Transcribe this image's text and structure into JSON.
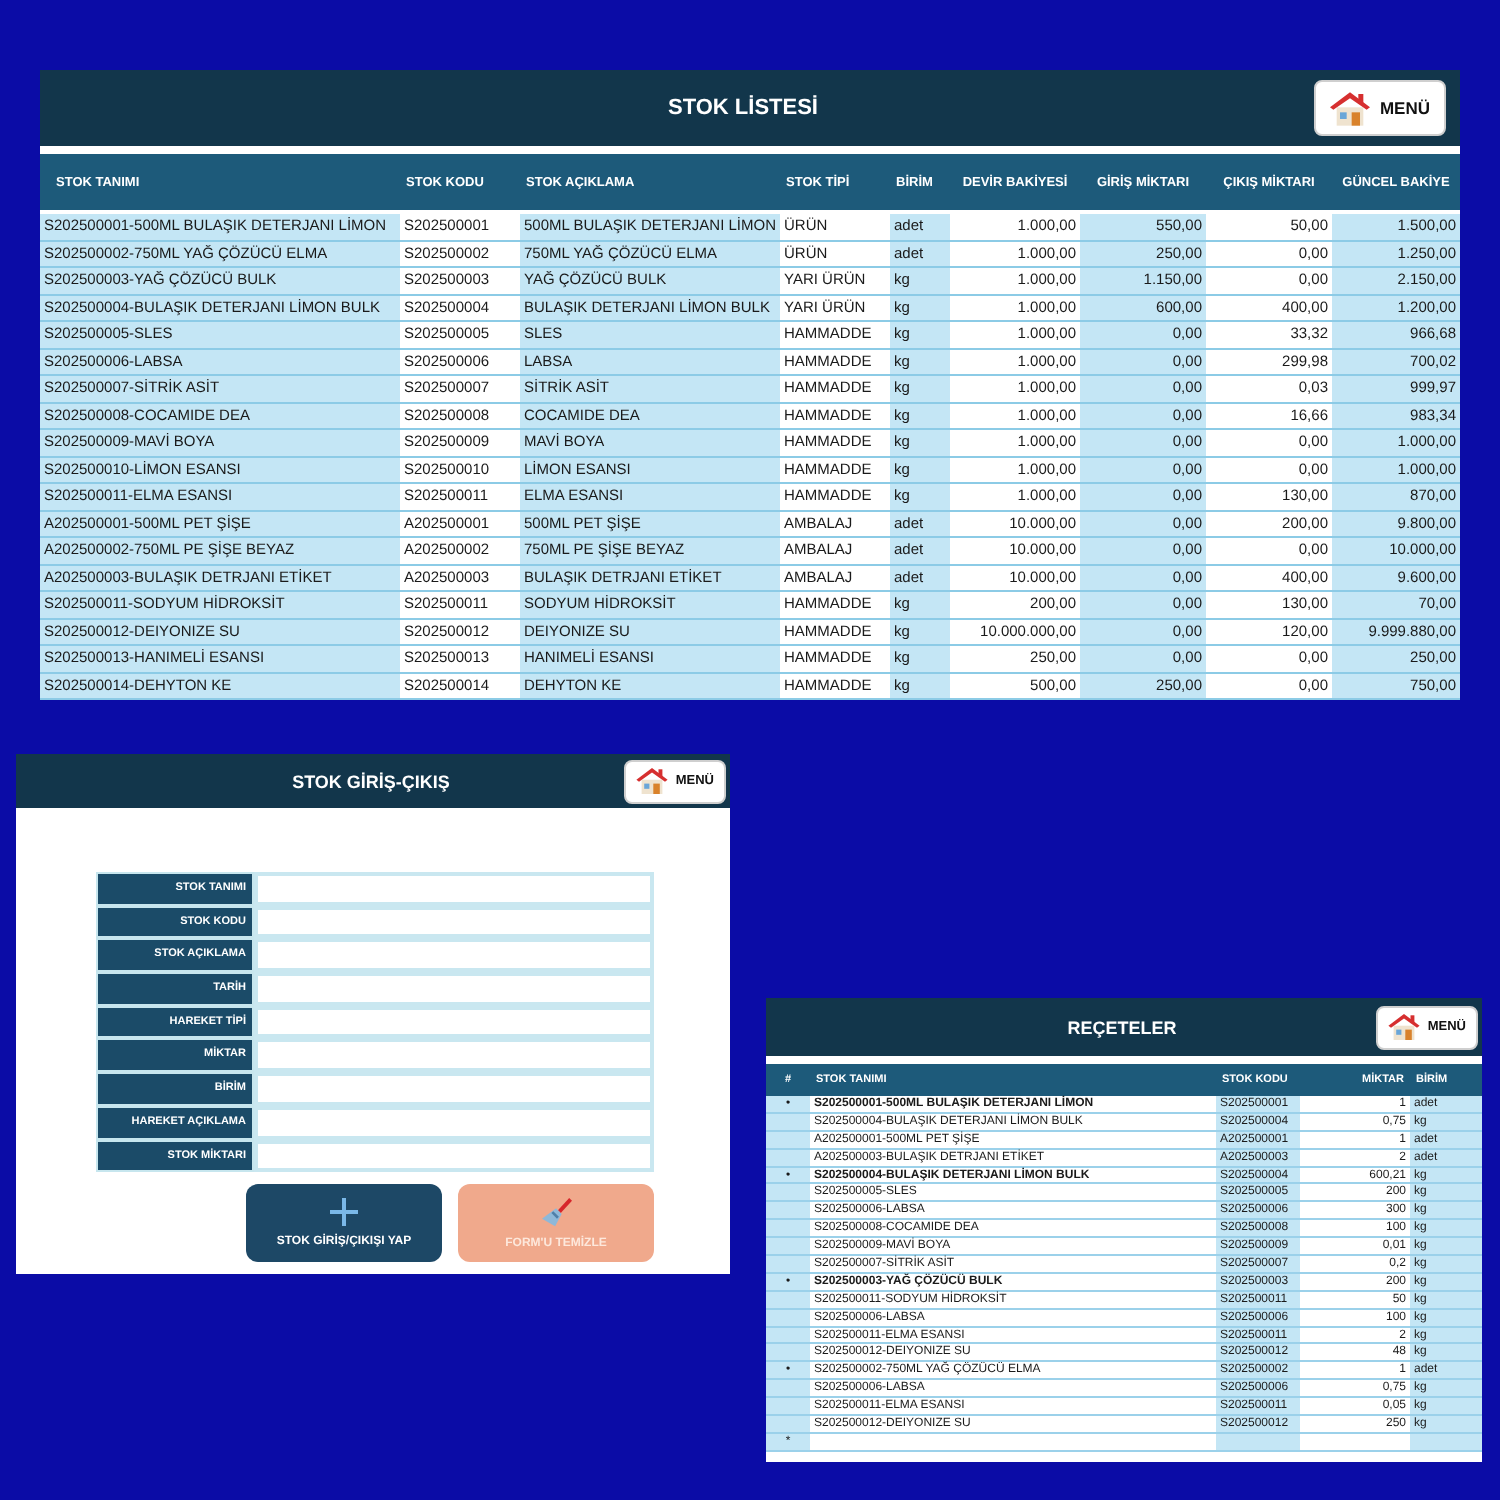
{
  "stock_list": {
    "title": "STOK LİSTESİ",
    "menu_button": "MENÜ",
    "columns": [
      "STOK TANIMI",
      "STOK KODU",
      "STOK AÇIKLAMA",
      "STOK TİPİ",
      "BİRİM",
      "DEVİR BAKİYESİ",
      "GİRİŞ MİKTARI",
      "ÇIKIŞ MİKTARI",
      "GÜNCEL BAKİYE"
    ],
    "rows": [
      [
        "S202500001-500ML BULAŞIK DETERJANI LİMON",
        "S202500001",
        "500ML BULAŞIK DETERJANI LİMON",
        "ÜRÜN",
        "adet",
        "1.000,00",
        "550,00",
        "50,00",
        "1.500,00"
      ],
      [
        "S202500002-750ML YAĞ ÇÖZÜCÜ ELMA",
        "S202500002",
        "750ML YAĞ ÇÖZÜCÜ ELMA",
        "ÜRÜN",
        "adet",
        "1.000,00",
        "250,00",
        "0,00",
        "1.250,00"
      ],
      [
        "S202500003-YAĞ ÇÖZÜCÜ BULK",
        "S202500003",
        "YAĞ ÇÖZÜCÜ BULK",
        "YARI ÜRÜN",
        "kg",
        "1.000,00",
        "1.150,00",
        "0,00",
        "2.150,00"
      ],
      [
        "S202500004-BULAŞIK DETERJANI LİMON BULK",
        "S202500004",
        "BULAŞIK DETERJANI LİMON BULK",
        "YARI ÜRÜN",
        "kg",
        "1.000,00",
        "600,00",
        "400,00",
        "1.200,00"
      ],
      [
        "S202500005-SLES",
        "S202500005",
        "SLES",
        "HAMMADDE",
        "kg",
        "1.000,00",
        "0,00",
        "33,32",
        "966,68"
      ],
      [
        "S202500006-LABSA",
        "S202500006",
        "LABSA",
        "HAMMADDE",
        "kg",
        "1.000,00",
        "0,00",
        "299,98",
        "700,02"
      ],
      [
        "S202500007-SİTRİK ASİT",
        "S202500007",
        "SİTRİK ASİT",
        "HAMMADDE",
        "kg",
        "1.000,00",
        "0,00",
        "0,03",
        "999,97"
      ],
      [
        "S202500008-COCAMIDE DEA",
        "S202500008",
        "COCAMIDE DEA",
        "HAMMADDE",
        "kg",
        "1.000,00",
        "0,00",
        "16,66",
        "983,34"
      ],
      [
        "S202500009-MAVİ BOYA",
        "S202500009",
        "MAVİ BOYA",
        "HAMMADDE",
        "kg",
        "1.000,00",
        "0,00",
        "0,00",
        "1.000,00"
      ],
      [
        "S202500010-LİMON ESANSI",
        "S202500010",
        "LİMON ESANSI",
        "HAMMADDE",
        "kg",
        "1.000,00",
        "0,00",
        "0,00",
        "1.000,00"
      ],
      [
        "S202500011-ELMA ESANSI",
        "S202500011",
        "ELMA ESANSI",
        "HAMMADDE",
        "kg",
        "1.000,00",
        "0,00",
        "130,00",
        "870,00"
      ],
      [
        "A202500001-500ML PET ŞİŞE",
        "A202500001",
        "500ML PET ŞİŞE",
        "AMBALAJ",
        "adet",
        "10.000,00",
        "0,00",
        "200,00",
        "9.800,00"
      ],
      [
        "A202500002-750ML PE ŞİŞE BEYAZ",
        "A202500002",
        "750ML PE ŞİŞE BEYAZ",
        "AMBALAJ",
        "adet",
        "10.000,00",
        "0,00",
        "0,00",
        "10.000,00"
      ],
      [
        "A202500003-BULAŞIK DETRJANI ETİKET",
        "A202500003",
        "BULAŞIK DETRJANI ETİKET",
        "AMBALAJ",
        "adet",
        "10.000,00",
        "0,00",
        "400,00",
        "9.600,00"
      ],
      [
        "S202500011-SODYUM HİDROKSİT",
        "S202500011",
        "SODYUM HİDROKSİT",
        "HAMMADDE",
        "kg",
        "200,00",
        "0,00",
        "130,00",
        "70,00"
      ],
      [
        "S202500012-DEIYONIZE SU",
        "S202500012",
        "DEIYONIZE SU",
        "HAMMADDE",
        "kg",
        "10.000.000,00",
        "0,00",
        "120,00",
        "9.999.880,00"
      ],
      [
        "S202500013-HANIMELİ ESANSI",
        "S202500013",
        "HANIMELİ ESANSI",
        "HAMMADDE",
        "kg",
        "250,00",
        "0,00",
        "0,00",
        "250,00"
      ],
      [
        "S202500014-DEHYTON KE",
        "S202500014",
        "DEHYTON KE",
        "HAMMADDE",
        "kg",
        "500,00",
        "250,00",
        "0,00",
        "750,00"
      ]
    ]
  },
  "stock_movement": {
    "title": "STOK GİRİŞ-ÇIKIŞ",
    "menu_button": "MENÜ",
    "fields": [
      {
        "label": "STOK TANIMI"
      },
      {
        "label": "STOK KODU"
      },
      {
        "label": "STOK AÇIKLAMA"
      },
      {
        "label": "TARİH"
      },
      {
        "label": "HAREKET TİPİ"
      },
      {
        "label": "MİKTAR"
      },
      {
        "label": "BİRİM"
      },
      {
        "label": "HAREKET AÇIKLAMA"
      },
      {
        "label": "STOK MİKTARI"
      }
    ],
    "buttons": [
      {
        "label": "STOK GİRİŞ/ÇIKIŞI YAP",
        "kind": "add"
      },
      {
        "label": "FORM'U TEMİZLE",
        "kind": "clear"
      }
    ]
  },
  "recipes": {
    "title": "REÇETELER",
    "menu_button": "MENÜ",
    "columns": [
      "#",
      "STOK TANIMI",
      "STOK KODU",
      "MİKTAR",
      "BİRİM"
    ],
    "rows": [
      {
        "marker": "•",
        "bold": true,
        "cells": [
          "S202500001-500ML BULAŞIK DETERJANI LİMON",
          "S202500001",
          "1",
          "adet"
        ]
      },
      {
        "bold": false,
        "cells": [
          "S202500004-BULAŞIK DETERJANI LİMON BULK",
          "S202500004",
          "0,75",
          "kg"
        ]
      },
      {
        "bold": false,
        "cells": [
          "A202500001-500ML PET ŞİŞE",
          "A202500001",
          "1",
          "adet"
        ]
      },
      {
        "bold": false,
        "cells": [
          "A202500003-BULAŞIK DETRJANI ETİKET",
          "A202500003",
          "2",
          "adet"
        ]
      },
      {
        "marker": "•",
        "bold": true,
        "cells": [
          "S202500004-BULAŞIK DETERJANI LİMON BULK",
          "S202500004",
          "600,21",
          "kg"
        ]
      },
      {
        "bold": false,
        "cells": [
          "S202500005-SLES",
          "S202500005",
          "200",
          "kg"
        ]
      },
      {
        "bold": false,
        "cells": [
          "S202500006-LABSA",
          "S202500006",
          "300",
          "kg"
        ]
      },
      {
        "bold": false,
        "cells": [
          "S202500008-COCAMIDE DEA",
          "S202500008",
          "100",
          "kg"
        ]
      },
      {
        "bold": false,
        "cells": [
          "S202500009-MAVİ BOYA",
          "S202500009",
          "0,01",
          "kg"
        ]
      },
      {
        "bold": false,
        "cells": [
          "S202500007-SİTRİK ASİT",
          "S202500007",
          "0,2",
          "kg"
        ]
      },
      {
        "marker": "•",
        "bold": true,
        "cells": [
          "S202500003-YAĞ ÇÖZÜCÜ BULK",
          "S202500003",
          "200",
          "kg"
        ]
      },
      {
        "bold": false,
        "cells": [
          "S202500011-SODYUM HİDROKSİT",
          "S202500011",
          "50",
          "kg"
        ]
      },
      {
        "bold": false,
        "cells": [
          "S202500006-LABSA",
          "S202500006",
          "100",
          "kg"
        ]
      },
      {
        "bold": false,
        "cells": [
          "S202500011-ELMA ESANSI",
          "S202500011",
          "2",
          "kg"
        ]
      },
      {
        "bold": false,
        "cells": [
          "S202500012-DEIYONIZE SU",
          "S202500012",
          "48",
          "kg"
        ]
      },
      {
        "marker": "•",
        "bold": false,
        "cells": [
          "S202500002-750ML YAĞ ÇÖZÜCÜ ELMA",
          "S202500002",
          "1",
          "adet"
        ]
      },
      {
        "bold": false,
        "cells": [
          "S202500006-LABSA",
          "S202500006",
          "0,75",
          "kg"
        ]
      },
      {
        "bold": false,
        "cells": [
          "S202500011-ELMA ESANSI",
          "S202500011",
          "0,05",
          "kg"
        ]
      },
      {
        "bold": false,
        "cells": [
          "S202500012-DEIYONIZE SU",
          "S202500012",
          "250",
          "kg"
        ]
      },
      {
        "marker": "*"
      }
    ]
  }
}
